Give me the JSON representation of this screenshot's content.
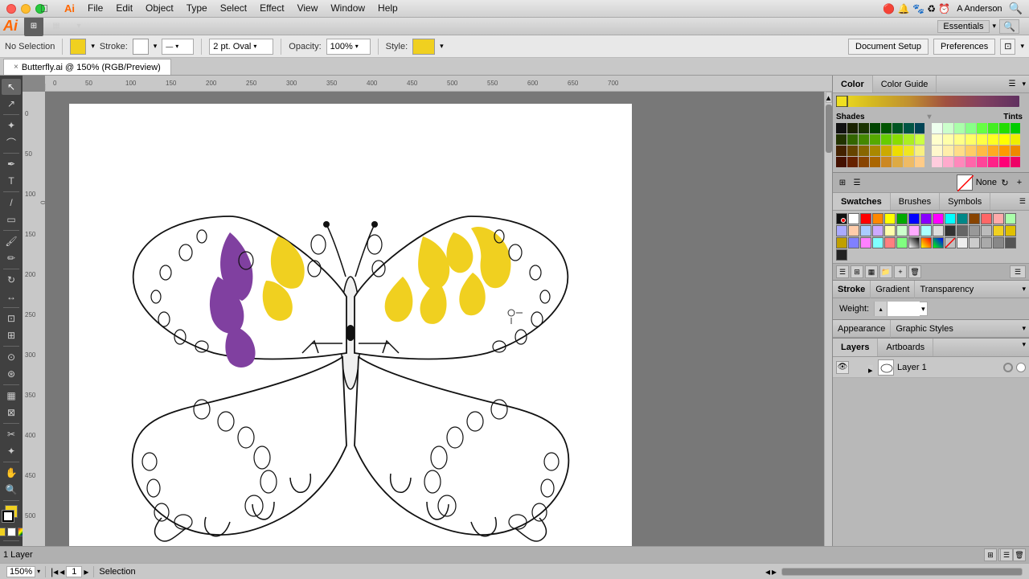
{
  "titlebar": {
    "app_name": "Illustrator",
    "apple_menu": "",
    "menus": [
      "",
      "Illustrator",
      "File",
      "Edit",
      "Object",
      "Type",
      "Select",
      "Effect",
      "View",
      "Window",
      "Help"
    ],
    "right_user": "A Anderson",
    "essentials": "Essentials"
  },
  "options_bar": {
    "no_selection": "No Selection",
    "stroke_label": "Stroke:",
    "brush_label": "2 pt. Oval",
    "opacity_label": "Opacity:",
    "opacity_value": "100%",
    "style_label": "Style:",
    "doc_setup_btn": "Document Setup",
    "preferences_btn": "Preferences"
  },
  "tab": {
    "name": "Butterfly.ai @ 150% (RGB/Preview)",
    "close": "×"
  },
  "tools": [
    "↖",
    "↗",
    "↻",
    "↺",
    "✏",
    "T",
    "/",
    "▭",
    "⬡",
    "◉",
    "✂",
    "⬜",
    "⊡",
    "✦",
    "⊕",
    "⊞",
    "⊟",
    "◎",
    "✥",
    "🔍"
  ],
  "color_panel": {
    "title": "Color",
    "guide_title": "Color Guide",
    "shades": "Shades",
    "tints": "Tints",
    "selected_none": "None"
  },
  "swatches_panel": {
    "tabs": [
      "Swatches",
      "Brushes",
      "Symbols"
    ]
  },
  "stroke_panel": {
    "title": "Stroke",
    "gradient_tab": "Gradient",
    "transparency_tab": "Transparency",
    "weight_label": "Weight:"
  },
  "appearance_panel": {
    "title": "Appearance",
    "graphic_styles_tab": "Graphic Styles"
  },
  "layers_panel": {
    "layers_tab": "Layers",
    "artboards_tab": "Artboards",
    "layer1_name": "Layer 1",
    "total_layers": "1 Layer"
  },
  "bottom_bar": {
    "zoom": "150%",
    "page": "1",
    "tool_name": "Selection"
  },
  "colors": {
    "accent_yellow": "#f0e020",
    "accent_purple": "#8040a0",
    "canvas_bg": "#787878",
    "panel_bg": "#b8b8b8",
    "dark_bg": "#404040"
  }
}
